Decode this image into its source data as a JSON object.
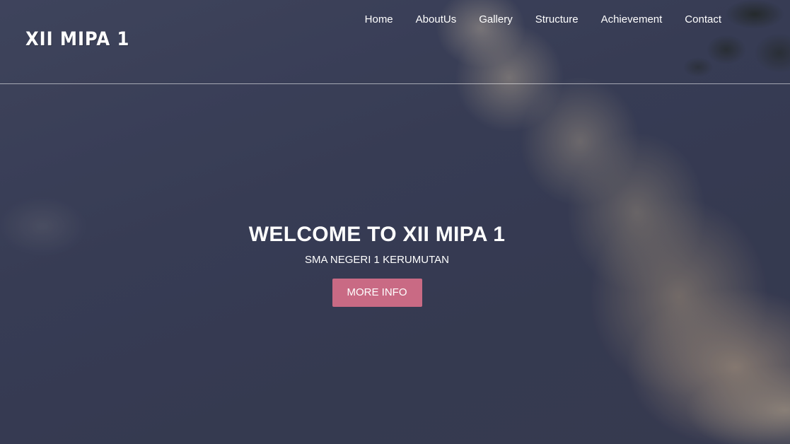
{
  "header": {
    "logo_text": "XII MIPA 1",
    "nav": [
      {
        "label": "Home"
      },
      {
        "label": "AboutUs"
      },
      {
        "label": "Gallery"
      },
      {
        "label": "Structure"
      },
      {
        "label": "Achievement"
      },
      {
        "label": "Contact"
      }
    ]
  },
  "hero": {
    "title": "WELCOME TO XII MIPA 1",
    "subtitle": "SMA NEGERI 1 KERUMUTAN",
    "button_label": "MORE INFO"
  },
  "colors": {
    "button_bg": "#c96a84",
    "sky": "#3b405a",
    "text": "#ffffff"
  }
}
